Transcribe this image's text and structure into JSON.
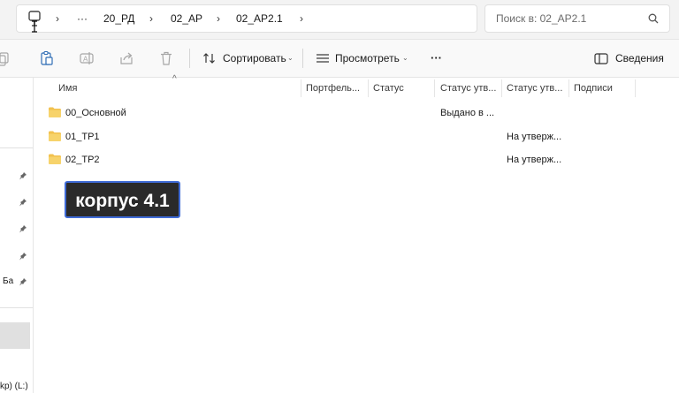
{
  "address": {
    "ellipsis": "···",
    "crumbs": [
      "20_РД",
      "02_АР",
      "02_АР2.1"
    ]
  },
  "search": {
    "placeholder": "Поиск в: 02_АР2.1"
  },
  "toolbar": {
    "sort_label": "Сортировать",
    "view_label": "Просмотреть",
    "more_label": "···",
    "details_label": "Сведения"
  },
  "columns": [
    "Имя",
    "Портфель...",
    "Статус",
    "Статус утв...",
    "Статус утв...",
    "Подписи"
  ],
  "rows": [
    {
      "name": "00_Основной",
      "status_a": "Выдано в ...",
      "status_b": ""
    },
    {
      "name": "01_ТР1",
      "status_a": "",
      "status_b": "На утверж..."
    },
    {
      "name": "02_ТР2",
      "status_a": "",
      "status_b": "На утверж..."
    }
  ],
  "nav": {
    "item_partial": "Ба",
    "drive_partial": "kp) (L:)"
  },
  "overlay": {
    "label": "корпус 4.1"
  },
  "colors": {
    "folder": "#f2c14e",
    "accent_border": "#3f6bd6",
    "badge_bg": "#2a2a2a"
  }
}
